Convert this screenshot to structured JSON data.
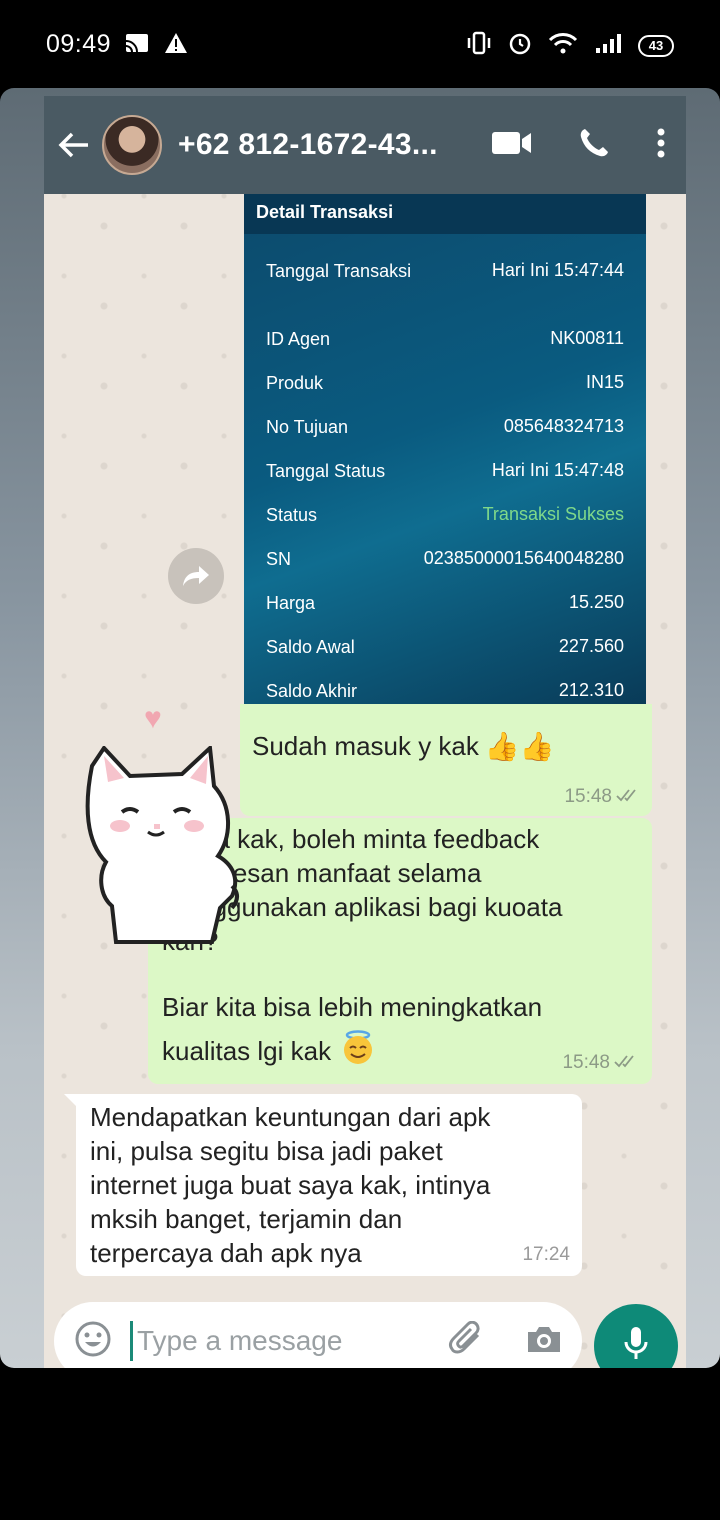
{
  "status_bar": {
    "time": "09:49",
    "battery": "43"
  },
  "header": {
    "contact_name": "+62 812-1672-43..."
  },
  "receipt": {
    "title": "Detail Transaksi",
    "rows": [
      {
        "label": "Tanggal Transaksi",
        "value": "Hari Ini 15:47:44"
      },
      {
        "label": "ID Agen",
        "value": "NK00811"
      },
      {
        "label": "Produk",
        "value": "IN15"
      },
      {
        "label": "No Tujuan",
        "value": "085648324713"
      },
      {
        "label": "Tanggal Status",
        "value": "Hari Ini 15:47:48"
      },
      {
        "label": "Status",
        "value": "Transaksi Sukses"
      },
      {
        "label": "SN",
        "value": "02385000015640048280"
      },
      {
        "label": "Harga",
        "value": "15.250"
      },
      {
        "label": "Saldo Awal",
        "value": "227.560"
      },
      {
        "label": "Saldo Akhir",
        "value": "212.310"
      }
    ],
    "status_color": "#7fd98a"
  },
  "messages": {
    "sent_1": {
      "text": "Sudah masuk y kak",
      "time": "15:48"
    },
    "sent_2": {
      "line1": "Ok ya kak, boleh minta feedback",
      "line2": "atau kesan manfaat selama",
      "line3": "menggunakan aplikasi bagi kuoata",
      "line4": "kah?",
      "line5": "Biar kita bisa lebih meningkatkan",
      "line6": "kualitas lgi kak",
      "time": "15:48"
    },
    "received": {
      "line1": "Mendapatkan keuntungan dari apk",
      "line2": "ini, pulsa segitu bisa jadi paket",
      "line3": "internet juga buat saya kak, intinya",
      "line4": "mksih banget, terjamin dan",
      "line5": "terpercaya dah apk nya",
      "time": "17:24"
    }
  },
  "input": {
    "placeholder": "Type a message"
  },
  "icons": {
    "back": "back-arrow-icon",
    "video": "video-call-icon",
    "call": "phone-call-icon",
    "menu": "more-vert-icon",
    "emoji": "emoji-icon",
    "attach": "attach-icon",
    "camera": "camera-icon",
    "mic": "mic-icon",
    "forward": "forward-icon"
  },
  "colors": {
    "header": "#4a5a63",
    "sent_bubble": "#dcf8c6",
    "received_bubble": "#ffffff",
    "accent": "#0e8a78"
  }
}
